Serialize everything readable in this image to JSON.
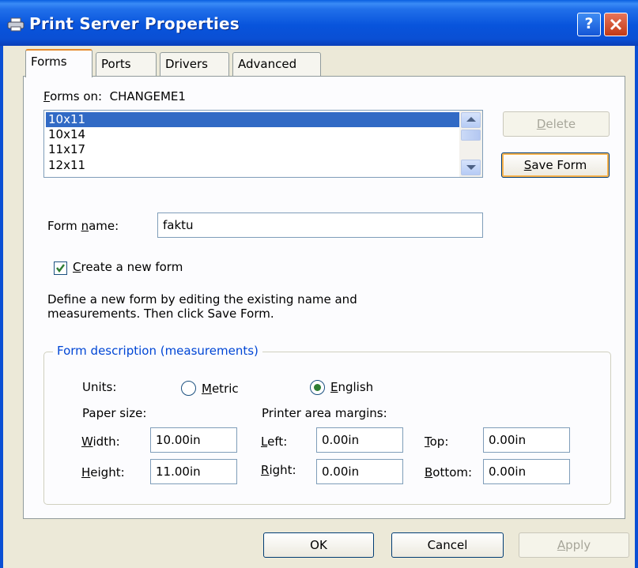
{
  "window": {
    "title": "Print Server Properties",
    "help_icon": "help-question-icon",
    "help_label": "?",
    "close_icon": "close-x-icon",
    "printer_icon": "printer-icon"
  },
  "tabs": [
    {
      "label": "Forms",
      "active": true
    },
    {
      "label": "Ports",
      "active": false
    },
    {
      "label": "Drivers",
      "active": false
    },
    {
      "label": "Advanced",
      "active": false
    }
  ],
  "forms_on": {
    "label_pre": "F",
    "label_rest": "orms on:",
    "server": "CHANGEME1"
  },
  "forms_list": {
    "items": [
      "10x11",
      "10x14",
      "11x17",
      "12x11"
    ],
    "selected": "10x11"
  },
  "buttons": {
    "delete_acc": "D",
    "delete_rest": "elete",
    "save_acc": "S",
    "save_rest": "ave Form",
    "ok": "OK",
    "cancel": "Cancel",
    "apply_acc": "A",
    "apply_rest": "pply"
  },
  "form_name": {
    "label_pre": "Form ",
    "label_acc": "n",
    "label_rest": "ame:",
    "value": "faktu"
  },
  "create_new": {
    "acc": "C",
    "rest": "reate a new form",
    "checked": true
  },
  "description": "Define a new form by editing the existing name and",
  "description2": "measurements.  Then click Save Form.",
  "measurements": {
    "group_title": "Form description (measurements)",
    "units_label": "Units:",
    "metric_acc": "M",
    "metric_rest": "etric",
    "english_acc": "E",
    "english_rest": "nglish",
    "selected_unit": "English",
    "paper_size_label": "Paper size:",
    "margins_label": "Printer area margins:",
    "width_acc": "W",
    "width_rest": "idth:",
    "width_value": "10.00in",
    "height_acc": "H",
    "height_rest": "eight:",
    "height_value": "11.00in",
    "left_acc": "L",
    "left_rest": "eft:",
    "left_value": "0.00in",
    "right_acc": "R",
    "right_rest": "ight:",
    "right_value": "0.00in",
    "top_acc": "T",
    "top_rest": "op:",
    "top_value": "0.00in",
    "bottom_acc": "B",
    "bottom_rest": "ottom:",
    "bottom_value": "0.00in"
  },
  "colors": {
    "titlebar": "#0a4fd4",
    "selection": "#316ac5",
    "group_title": "#0046d5",
    "check": "#2e7d32"
  }
}
